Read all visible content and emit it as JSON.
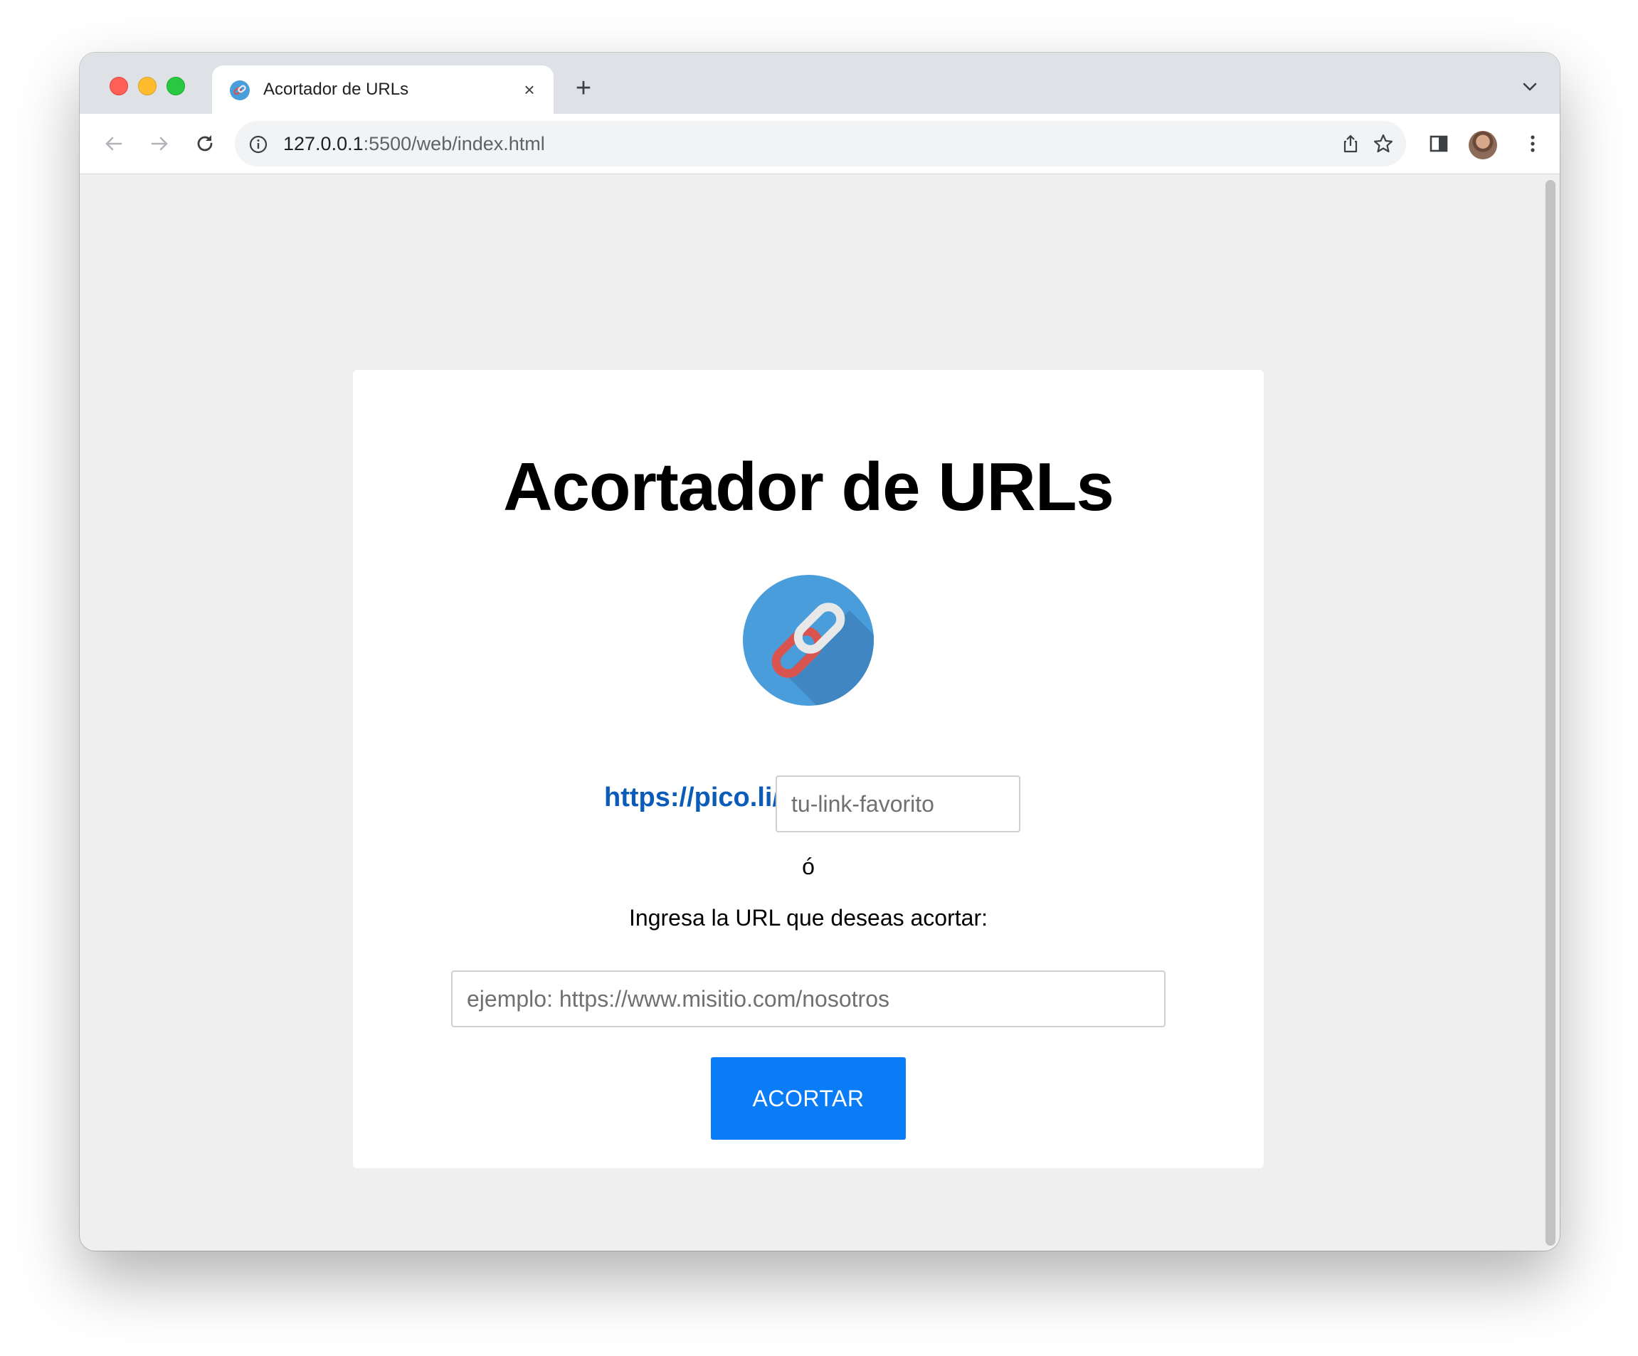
{
  "browser": {
    "tab": {
      "title": "Acortador de URLs",
      "close_icon": "×"
    },
    "new_tab_icon": "+",
    "address": {
      "host": "127.0.0.1",
      "rest": ":5500/web/index.html"
    }
  },
  "page": {
    "title": "Acortador de URLs",
    "logo_icon": "chain-link",
    "prefix": "https://pico.li/",
    "alias_placeholder": "tu-link-favorito",
    "or_text": "ó",
    "instruction": "Ingresa la URL que deseas acortar:",
    "url_placeholder": "ejemplo: https://www.misitio.com/nosotros",
    "submit_label": "ACORTAR"
  },
  "colors": {
    "accent_button": "#0a7cf8",
    "prefix_link": "#0b5cb8",
    "page_background": "#efefef"
  }
}
